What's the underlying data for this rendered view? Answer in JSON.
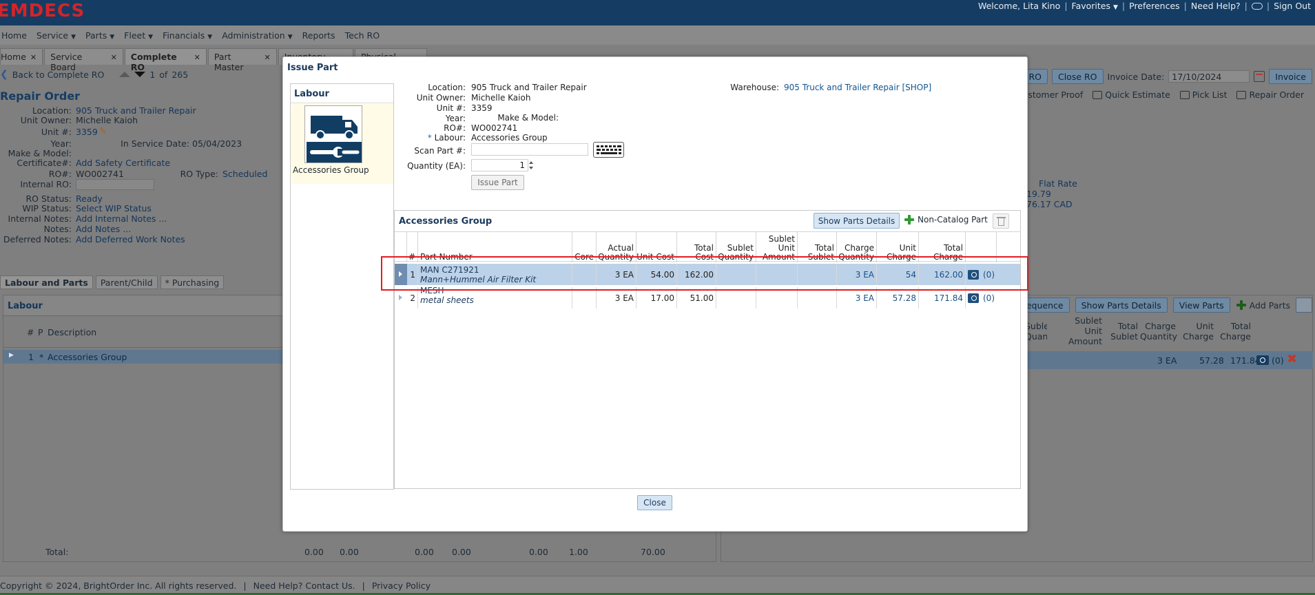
{
  "app": {
    "logo": "EMDECS",
    "welcome": "Welcome, Lita Kino",
    "top_links": [
      "Favorites",
      "Preferences",
      "Need Help?",
      "Sign Out"
    ]
  },
  "menu": [
    "Home",
    "Service",
    "Parts",
    "Fleet",
    "Financials",
    "Administration",
    "Reports",
    "Tech RO"
  ],
  "tabs": [
    "Home",
    "Service Board",
    "Complete RO",
    "Part Master",
    "Inventory Audit",
    "Physical Count"
  ],
  "nav": {
    "back": "Back to Complete RO",
    "position": "1",
    "of": "of",
    "total": "265"
  },
  "ro": {
    "title": "Repair Order",
    "location_label": "Location:",
    "location": "905 Truck and Trailer Repair",
    "owner_label": "Unit Owner:",
    "owner": "Michelle Kaioh",
    "unit_label": "Unit #:",
    "unit": "3359",
    "year_label": "Year:",
    "service_date_label": "In Service Date:",
    "service_date": "05/04/2023",
    "make_label": "Make & Model:",
    "cert_label": "Certificate#:",
    "cert": "Add Safety Certificate",
    "ro_label": "RO#:",
    "ro_num": "WO002741",
    "ro_type_label": "RO Type:",
    "ro_type": "Scheduled",
    "internal_ro_label": "Internal RO:",
    "status_label": "RO Status:",
    "status": "Ready",
    "wip_label": "WIP Status:",
    "wip": "Select WIP Status",
    "internal_notes_label": "Internal Notes:",
    "internal_notes": "Add Internal Notes ...",
    "notes_label": "Notes:",
    "notes": "Add Notes ...",
    "deferred_label": "Deferred Notes:",
    "deferred": "Add Deferred Work Notes"
  },
  "right_header": {
    "ro_btn": "RO",
    "close_ro": "Close RO",
    "invoice_date_label": "Invoice Date:",
    "invoice_date": "17/10/2024",
    "invoice": "Invoice",
    "links": [
      "Customer Proof",
      "Quick Estimate",
      "Pick List",
      "Repair Order"
    ],
    "flat_rate": "Flat Rate",
    "flat_val1": "19.79",
    "flat_val2": "76.17 CAD"
  },
  "subtabs": [
    "Labour and Parts",
    "Parent/Child",
    "* Purchasing"
  ],
  "labour": {
    "title": "Labour",
    "cols": [
      "#",
      "P",
      "Description"
    ],
    "row": {
      "num": "1",
      "p": "*",
      "desc": "Accessories Group"
    },
    "total_label": "Total:",
    "totals": [
      "0.00",
      "0.00",
      "0.00",
      "0.00",
      "0.00",
      "1.00",
      "70.00"
    ]
  },
  "parts_bg": {
    "buttons": [
      "Sequence",
      "Show Parts Details",
      "View Parts",
      "Add Parts"
    ],
    "cols": [
      "Sublet Quantity",
      "Sublet Unit Amount",
      "Total Sublet",
      "Charge Quantity",
      "Unit Charge",
      "Total Charge"
    ],
    "row": {
      "charge_qty": "3 EA",
      "unit_charge": "57.28",
      "total_charge": "171.84",
      "att": "(0)"
    }
  },
  "footer": {
    "copyright": "Copyright © 2024, BrightOrder Inc. All rights reserved.",
    "help": "Need Help? Contact Us.",
    "privacy": "Privacy Policy"
  },
  "modal": {
    "title": "Issue Part",
    "left_header": "Labour",
    "tile_label": "Accessories Group",
    "fields": {
      "location_label": "Location:",
      "location": "905 Truck and Trailer Repair",
      "owner_label": "Unit Owner:",
      "owner": "Michelle Kaioh",
      "unit_label": "Unit #:",
      "unit": "3359",
      "year_label": "Year:",
      "make_label": "Make & Model:",
      "ro_label": "RO#:",
      "ro": "WO002741",
      "labour_req": "*",
      "labour_label": "Labour:",
      "labour": "Accessories Group",
      "scan_label": "Scan Part #:",
      "qty_label": "Quantity (EA):",
      "qty": "1",
      "warehouse_label": "Warehouse:",
      "warehouse": "905 Truck and Trailer Repair [SHOP]"
    },
    "issue_btn": "Issue Part",
    "grid_title": "Accessories Group",
    "show_details": "Show Parts Details",
    "non_catalog": "Non-Catalog Part",
    "headers": {
      "num": "#",
      "part": "Part Number",
      "core": "Core",
      "actual": [
        "Actual",
        "Quantity"
      ],
      "unit_cost": "Unit Cost",
      "total_cost": [
        "Total",
        "Cost"
      ],
      "sublet_qty": [
        "Sublet",
        "Quantity"
      ],
      "sublet_unit": [
        "Sublet",
        "Unit",
        "Amount"
      ],
      "total_sublet": [
        "Total",
        "Sublet"
      ],
      "charge_qty": [
        "Charge",
        "Quantity"
      ],
      "unit_charge": [
        "Unit",
        "Charge"
      ],
      "total_charge": [
        "Total",
        "Charge"
      ]
    },
    "rows": [
      {
        "num": "1",
        "part": "MAN C271921",
        "desc": "Mann+Hummel Air Filter Kit",
        "actual": "3 EA",
        "unit_cost": "54.00",
        "total_cost": "162.00",
        "charge_qty": "3 EA",
        "unit_charge": "54",
        "total_charge": "162.00",
        "att": "(0)"
      },
      {
        "num": "2",
        "part": "MESH",
        "desc": "metal sheets",
        "actual": "3 EA",
        "unit_cost": "17.00",
        "total_cost": "51.00",
        "charge_qty": "3 EA",
        "unit_charge": "57.28",
        "total_charge": "171.84",
        "att": "(0)"
      }
    ],
    "close": "Close"
  }
}
